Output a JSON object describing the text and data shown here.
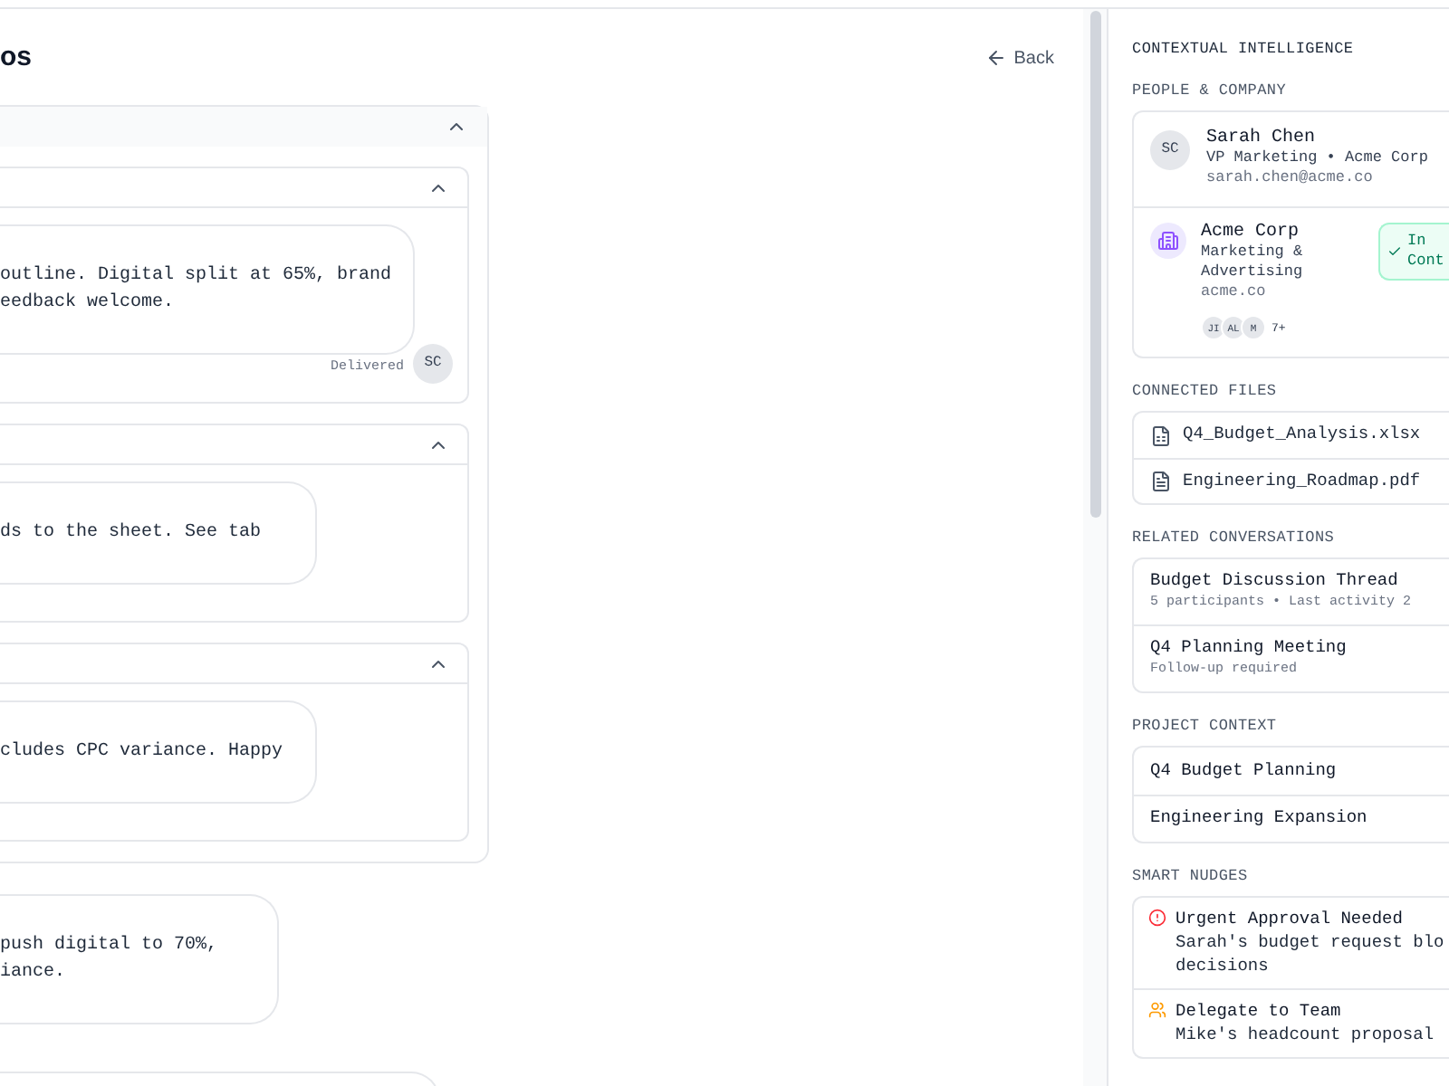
{
  "header": {
    "title": "os",
    "back": "Back"
  },
  "thread": {
    "expanded": true,
    "groups": [
      {
        "expanded": true,
        "message": {
          "lines": [
            "outline. Digital split at 65%, brand",
            "eedback welcome."
          ],
          "status": "Delivered",
          "avatar": "SC"
        }
      },
      {
        "expanded": true,
        "message": {
          "lines": [
            "ds to the sheet. See tab"
          ]
        }
      },
      {
        "expanded": true,
        "message": {
          "lines": [
            "cludes CPC variance. Happy"
          ]
        }
      }
    ]
  },
  "messages": [
    {
      "lines": [
        "push digital to 70%,",
        "iance."
      ]
    }
  ],
  "sidebar": {
    "title": "CONTEXTUAL INTELLIGENCE",
    "people": {
      "heading": "PEOPLE & COMPANY",
      "person": {
        "avatar": "SC",
        "name": "Sarah Chen",
        "role": "VP Marketing • Acme Corp",
        "email": "sarah.chen@acme.co"
      },
      "company": {
        "name": "Acme Corp",
        "industry": "Marketing & Advertising",
        "domain": "acme.co",
        "members": [
          "JI",
          "AL",
          "M"
        ],
        "more": "7+",
        "status": "In Cont"
      }
    },
    "files": {
      "heading": "CONNECTED FILES",
      "items": [
        {
          "name": "Q4_Budget_Analysis.xlsx",
          "kind": "sheet"
        },
        {
          "name": "Engineering_Roadmap.pdf",
          "kind": "doc"
        }
      ]
    },
    "conversations": {
      "heading": "RELATED CONVERSATIONS",
      "items": [
        {
          "title": "Budget Discussion Thread",
          "meta": "5 participants • Last activity 2"
        },
        {
          "title": "Q4 Planning Meeting",
          "meta": "Follow-up required"
        }
      ]
    },
    "projects": {
      "heading": "PROJECT CONTEXT",
      "items": [
        "Q4 Budget Planning",
        "Engineering Expansion"
      ]
    },
    "nudges": {
      "heading": "SMART NUDGES",
      "items": [
        {
          "kind": "urgent",
          "title": "Urgent Approval Needed",
          "lines": [
            "Sarah's budget request blo",
            "decisions"
          ]
        },
        {
          "kind": "delegate",
          "title": "Delegate to Team",
          "lines": [
            "Mike's headcount proposal"
          ]
        }
      ]
    }
  }
}
